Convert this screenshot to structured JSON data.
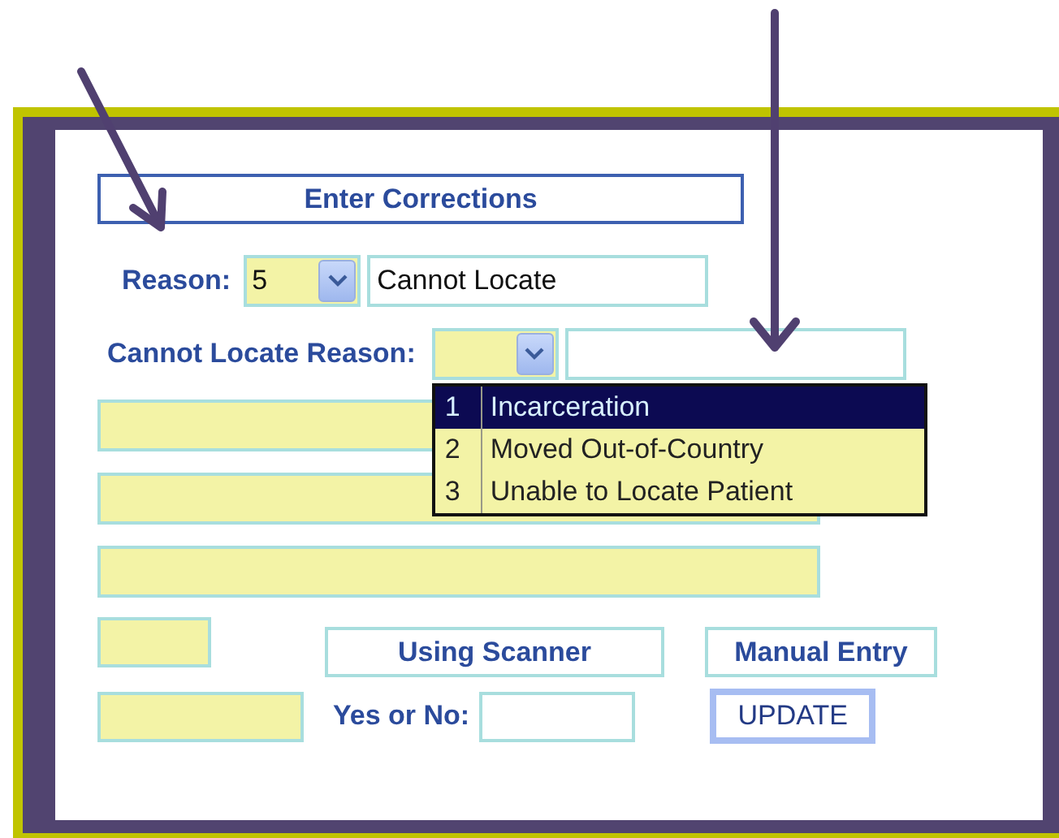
{
  "form": {
    "title": "Enter Corrections",
    "reason": {
      "label": "Reason:",
      "code": "5",
      "description": "Cannot Locate"
    },
    "cannot_locate_reason": {
      "label": "Cannot Locate Reason:",
      "expanded": true,
      "options": [
        {
          "number": "1",
          "label": "Incarceration",
          "selected": true
        },
        {
          "number": "2",
          "label": "Moved Out-of-Country",
          "selected": false
        },
        {
          "number": "3",
          "label": "Unable to Locate Patient",
          "selected": false
        }
      ]
    },
    "buttons": [
      {
        "label": "Using Scanner"
      },
      {
        "label": "Manual Entry"
      }
    ],
    "yes_no": {
      "label": "Yes or No:"
    },
    "update_button": {
      "label": "UPDATE"
    }
  },
  "annotations": [
    {
      "kind": "arrow"
    },
    {
      "kind": "arrow"
    }
  ]
}
